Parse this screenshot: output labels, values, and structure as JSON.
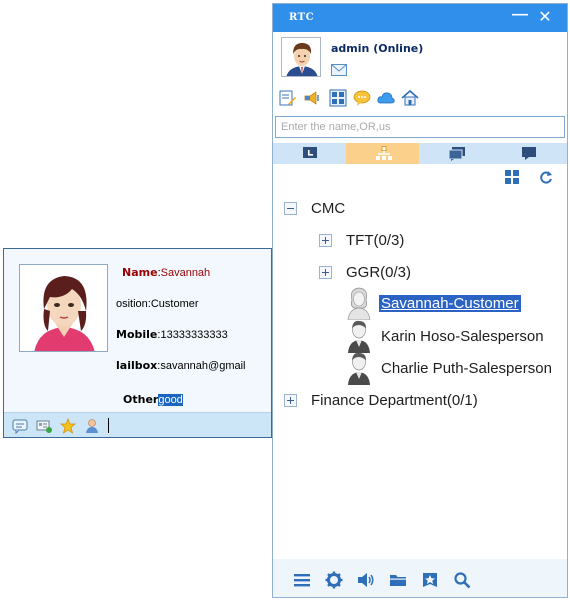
{
  "card": {
    "name_label": "Name",
    "name_value": "Savannah",
    "position_label": "osition",
    "position_value": "Customer",
    "mobile_label": "Mobile",
    "mobile_value": "13333333333",
    "mailbox_label": "lailbox",
    "mailbox_value": "savannah@gmail",
    "other_label": "Other",
    "other_value": "good",
    "toolbar_icons": [
      "chat-icon",
      "card-icon",
      "star-icon",
      "user-icon"
    ]
  },
  "window": {
    "title": "RTC",
    "minimize_glyph": "—",
    "close_glyph": "✕",
    "user_status": "admin (Online)",
    "app_icons": [
      "edit-icon",
      "broadcast-icon",
      "grid-app-icon",
      "message-bubble-icon",
      "cloud-icon",
      "home-icon"
    ],
    "search_placeholder": "Enter the name,OR,us",
    "tabs": [
      "recent-tab",
      "organization-tab",
      "groups-tab",
      "chat-tab"
    ],
    "active_tab": "organization-tab",
    "tree": {
      "root": "CMC",
      "groups": [
        "TFT(0/3)",
        "GGR(0/3)"
      ],
      "members": [
        "Savannah-Customer",
        "Karin Hoso-Salesperson",
        "Charlie Puth-Salesperson"
      ],
      "other_dept": "Finance Department(0/1)"
    },
    "bottom_icons": [
      "menu-icon",
      "settings-icon",
      "volume-icon",
      "folder-icon",
      "star-badge-icon",
      "search-icon"
    ]
  },
  "colors": {
    "titlebar": "#2f8fea",
    "selection": "#2b63c4",
    "active_tab": "#fbd08a",
    "name_label": "#9a0000"
  }
}
